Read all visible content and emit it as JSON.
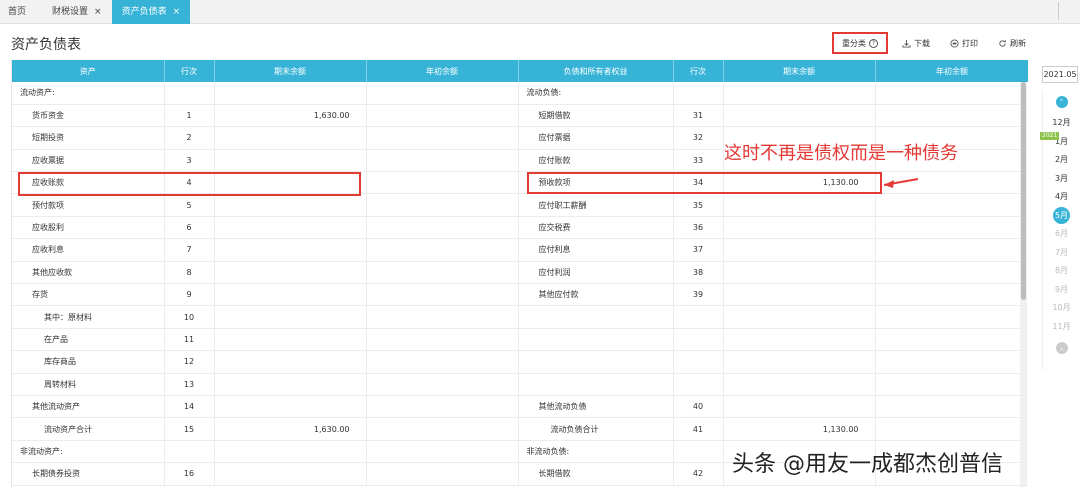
{
  "tabs": [
    {
      "label": "首页"
    },
    {
      "label": "财税设置",
      "close": "×"
    },
    {
      "label": "资产负债表",
      "close": "×"
    }
  ],
  "page_title": "资产负债表",
  "toolbar": {
    "reclassify": "重分类",
    "help": "?",
    "download": "下载",
    "print": "打印",
    "refresh": "刷新"
  },
  "table": {
    "headers": [
      "资产",
      "行次",
      "期末余额",
      "年初余额",
      "负债和所有者权益",
      "行次",
      "期末余额",
      "年初余额"
    ],
    "rows": [
      [
        "流动资产:",
        "",
        "",
        "",
        "流动负债:",
        "",
        "",
        ""
      ],
      [
        "货币资金",
        "1",
        "1,630.00",
        "",
        "短期借款",
        "31",
        "",
        ""
      ],
      [
        "短期投资",
        "2",
        "",
        "",
        "应付票据",
        "32",
        "",
        ""
      ],
      [
        "应收票据",
        "3",
        "",
        "",
        "应付账款",
        "33",
        "",
        ""
      ],
      [
        "应收账款",
        "4",
        "",
        "",
        "预收款项",
        "34",
        "1,130.00",
        ""
      ],
      [
        "预付款项",
        "5",
        "",
        "",
        "应付职工薪酬",
        "35",
        "",
        ""
      ],
      [
        "应收股利",
        "6",
        "",
        "",
        "应交税费",
        "36",
        "",
        ""
      ],
      [
        "应收利息",
        "7",
        "",
        "",
        "应付利息",
        "37",
        "",
        ""
      ],
      [
        "其他应收款",
        "8",
        "",
        "",
        "应付利润",
        "38",
        "",
        ""
      ],
      [
        "存货",
        "9",
        "",
        "",
        "其他应付款",
        "39",
        "",
        ""
      ],
      [
        "其中：原材料",
        "10",
        "",
        "",
        "",
        "",
        "",
        ""
      ],
      [
        "在产品",
        "11",
        "",
        "",
        "",
        "",
        "",
        ""
      ],
      [
        "库存商品",
        "12",
        "",
        "",
        "",
        "",
        "",
        ""
      ],
      [
        "周转材料",
        "13",
        "",
        "",
        "",
        "",
        "",
        ""
      ],
      [
        "其他流动资产",
        "14",
        "",
        "",
        "其他流动负债",
        "40",
        "",
        ""
      ],
      [
        "流动资产合计",
        "15",
        "1,630.00",
        "",
        "流动负债合计",
        "41",
        "1,130.00",
        ""
      ],
      [
        "非流动资产:",
        "",
        "",
        "",
        "非流动负债:",
        "",
        "",
        ""
      ],
      [
        "长期债券投资",
        "16",
        "",
        "",
        "长期借款",
        "42",
        "",
        ""
      ]
    ],
    "indent_left": [
      0,
      1,
      1,
      1,
      1,
      1,
      1,
      1,
      1,
      1,
      2,
      2,
      2,
      2,
      1,
      2,
      0,
      1
    ],
    "indent_right": [
      0,
      1,
      1,
      1,
      1,
      1,
      1,
      1,
      1,
      1,
      0,
      0,
      0,
      0,
      1,
      2,
      0,
      1
    ]
  },
  "annotation": "这时不再是债权而是一种债务",
  "date_picker": {
    "current": "2021.05",
    "year_badge": "2021",
    "months": [
      "12月",
      "1月",
      "2月",
      "3月",
      "4月",
      "5月",
      "6月",
      "7月",
      "8月",
      "9月",
      "10月",
      "11月"
    ],
    "selected_index": 5,
    "disabled_from_index": 6
  },
  "watermark": "头条 @用友一成都杰创普信",
  "colors": {
    "accent": "#36b3d6",
    "annotation": "#e53935",
    "badge": "#8bc34a"
  }
}
